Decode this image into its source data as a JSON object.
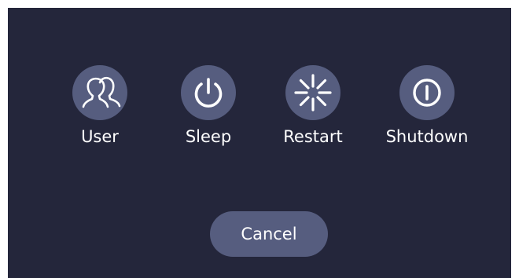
{
  "dialog": {
    "options": [
      {
        "label": "User",
        "icon": "user-icon"
      },
      {
        "label": "Sleep",
        "icon": "power-icon"
      },
      {
        "label": "Restart",
        "icon": "restart-icon"
      },
      {
        "label": "Shutdown",
        "icon": "shutdown-icon"
      }
    ],
    "cancel_label": "Cancel"
  },
  "colors": {
    "background": "#24263b",
    "button": "#565d7f",
    "foreground": "#ffffff"
  }
}
